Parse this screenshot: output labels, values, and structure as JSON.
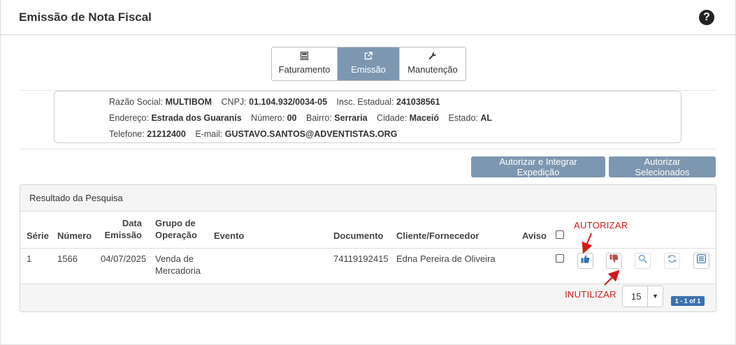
{
  "header": {
    "title": "Emissão de Nota Fiscal",
    "help_icon": "?"
  },
  "tabs": [
    {
      "label": "Faturamento",
      "icon": "calculator-icon",
      "active": false
    },
    {
      "label": "Emissão",
      "icon": "external-link-icon",
      "active": true
    },
    {
      "label": "Manutenção",
      "icon": "wrench-icon",
      "active": false
    }
  ],
  "company": {
    "razao_label": "Razão Social:",
    "razao": "MULTIBOM",
    "cnpj_label": "CNPJ:",
    "cnpj": "01.104.932/0034-05",
    "insc_label": "Insc. Estadual:",
    "insc": "241038561",
    "endereco_label": "Endereço:",
    "endereco": "Estrada dos Guaranís",
    "numero_label": "Número:",
    "numero": "00",
    "bairro_label": "Bairro:",
    "bairro": "Serraria",
    "cidade_label": "Cidade:",
    "cidade": "Maceió",
    "estado_label": "Estado:",
    "estado": "AL",
    "telefone_label": "Telefone:",
    "telefone": "21212400",
    "email_label": "E-mail:",
    "email": "GUSTAVO.SANTOS@ADVENTISTAS.ORG"
  },
  "actions": {
    "autorizar_expedicao": "Autorizar e Integrar Expedição",
    "autorizar_selecionados": "Autorizar Selecionados"
  },
  "results": {
    "title": "Resultado da Pesquisa",
    "columns": {
      "serie": "Série",
      "numero": "Número",
      "data_1": "Data",
      "data_2": "Emissão",
      "grupo_1": "Grupo de",
      "grupo_2": "Operação",
      "evento": "Evento",
      "documento": "Documento",
      "cliente": "Cliente/Fornecedor",
      "aviso": "Aviso"
    },
    "rows": [
      {
        "serie": "1",
        "numero": "1566",
        "data": "04/07/2025",
        "grupo_1": "Venda de",
        "grupo_2": "Mercadoria",
        "evento": "",
        "documento": "74119192415",
        "cliente": "Edna Pereira de Oliveira"
      }
    ]
  },
  "annotations": {
    "autorizar": "AUTORIZAR",
    "inutilizar": "INUTILIZAR",
    "color": "#d21a1a"
  },
  "pagination": {
    "page_size": "15",
    "range": "1 - 1 of 1"
  },
  "colors": {
    "accent": "#7d97b0",
    "badge": "#3a72b0"
  }
}
